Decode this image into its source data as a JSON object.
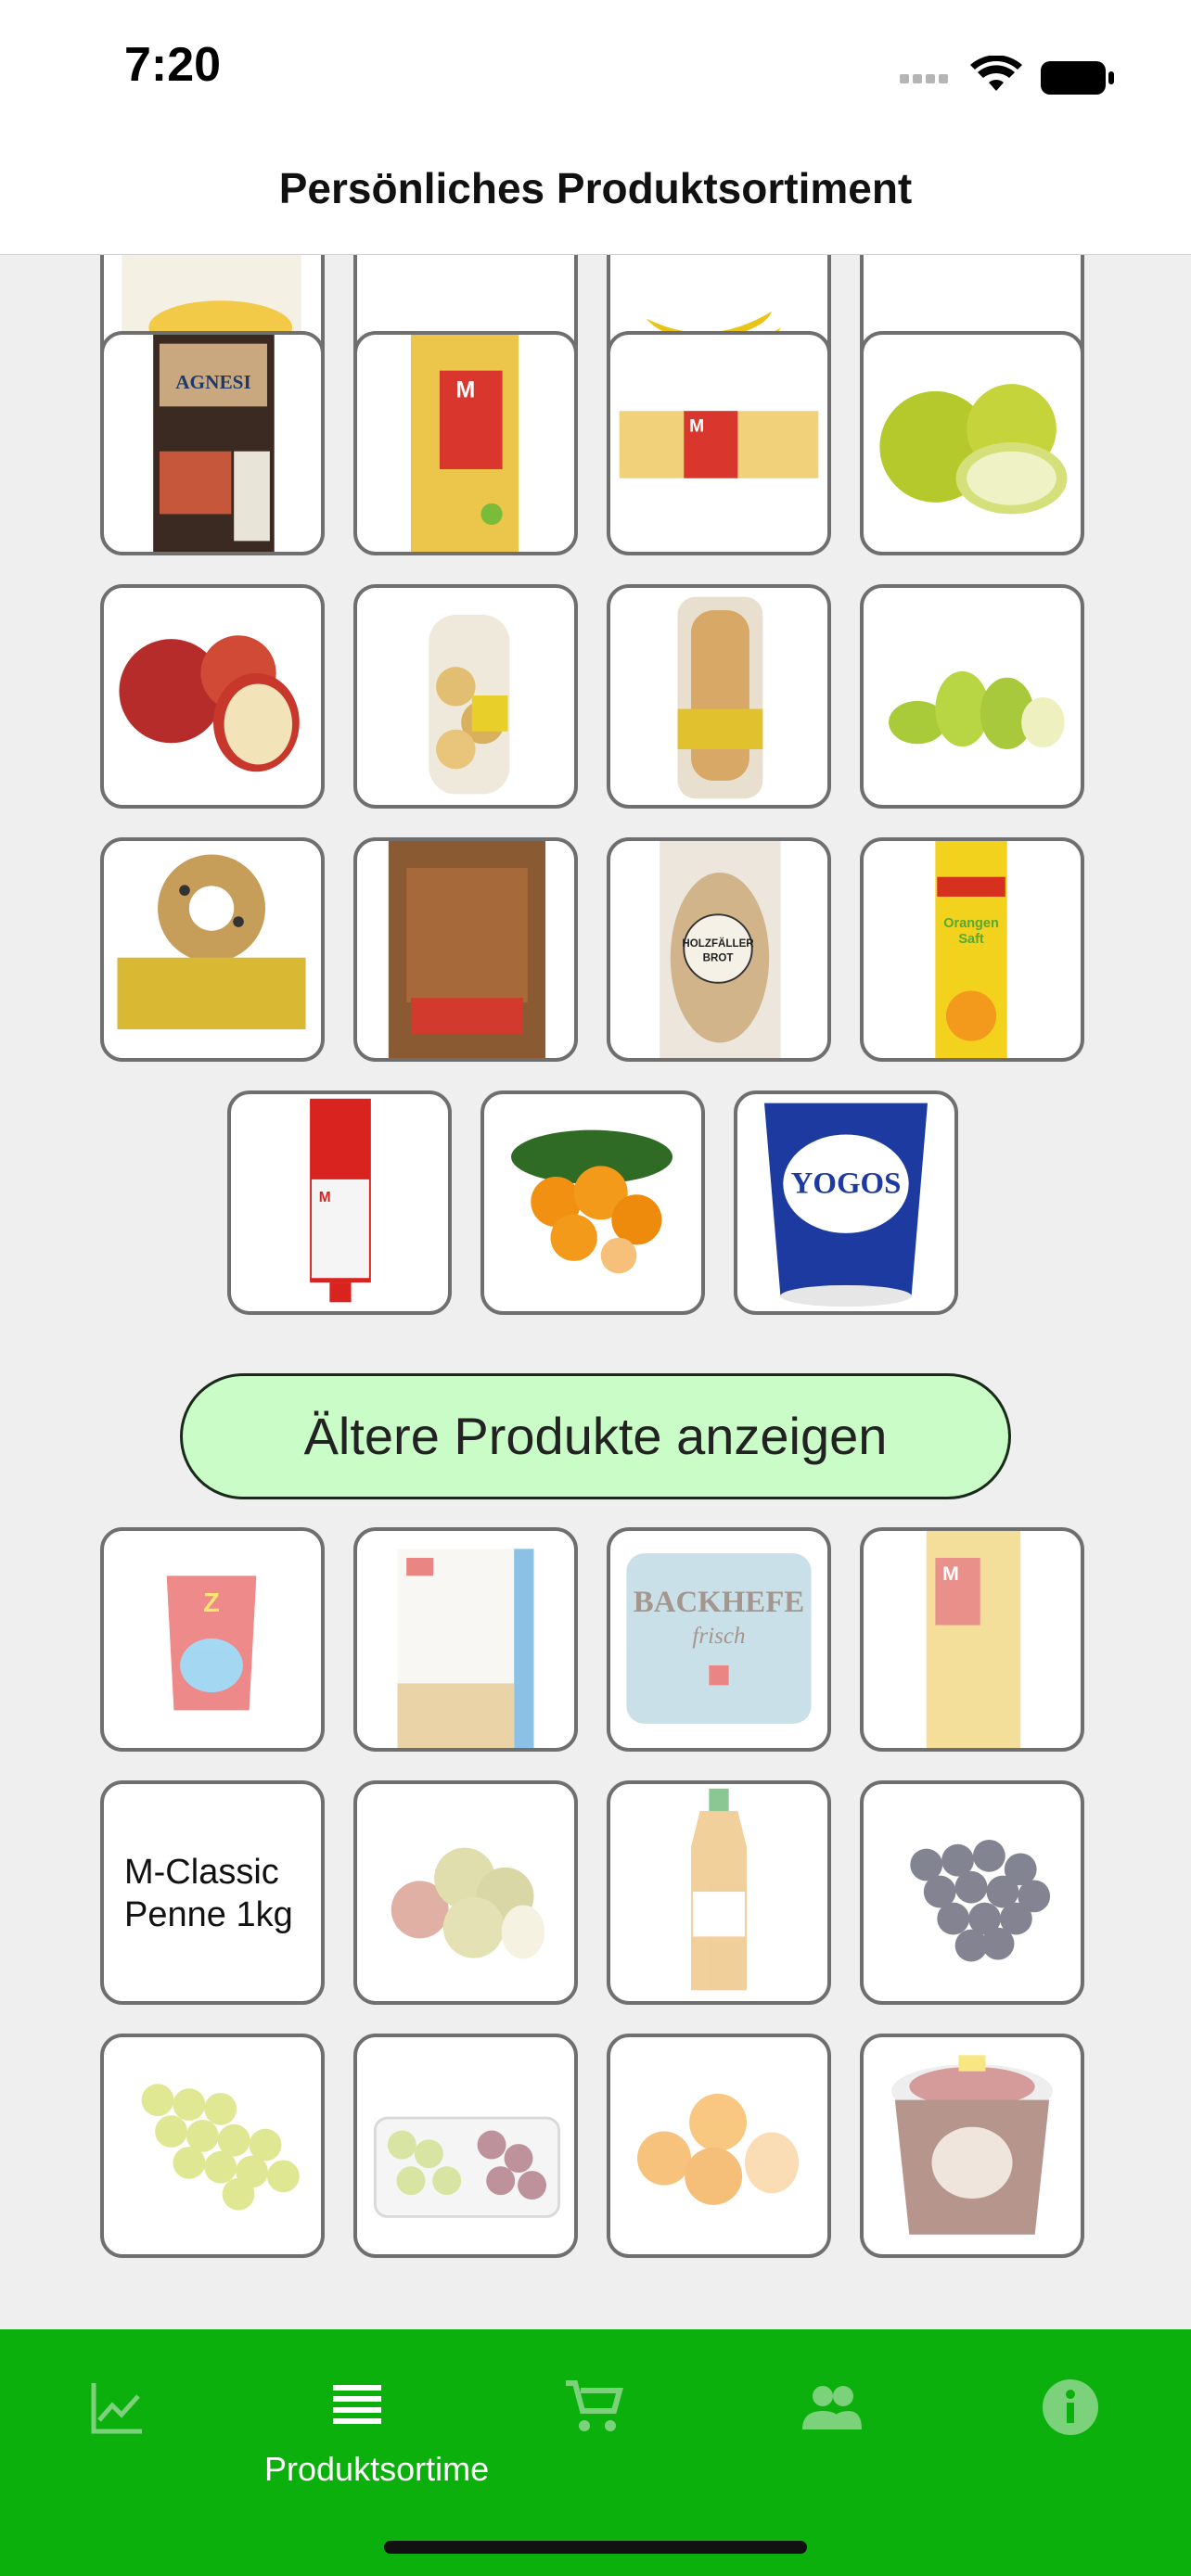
{
  "status_bar": {
    "time": "7:20"
  },
  "header": {
    "title": "Persönliches Produktsortiment"
  },
  "recent_products": [
    {
      "name": "Polenta"
    },
    {
      "name": "Produkt"
    },
    {
      "name": "Bananen"
    },
    {
      "name": "Produkt"
    },
    {
      "name": "Agnesi Lasagne"
    },
    {
      "name": "M Hörnli"
    },
    {
      "name": "M Spaghettini"
    },
    {
      "name": "Äpfel grün"
    },
    {
      "name": "Äpfel rot"
    },
    {
      "name": "Brötchen"
    },
    {
      "name": "Baguette"
    },
    {
      "name": "Birnen"
    },
    {
      "name": "Knusperkranz"
    },
    {
      "name": "Brot"
    },
    {
      "name": "Holzfäller-Brot"
    },
    {
      "name": "Orangensaft"
    },
    {
      "name": "Tomatenpüree"
    },
    {
      "name": "Mandarinen"
    },
    {
      "name": "Yogos Nature"
    }
  ],
  "older_button": {
    "label": "Ältere Produkte anzeigen"
  },
  "older_products": [
    {
      "name": "Zweifel Chips"
    },
    {
      "name": "Weissmehl"
    },
    {
      "name": "Backhefe frisch"
    },
    {
      "name": "M Nudeln"
    },
    {
      "name": "M-Classic Penne 1kg",
      "text": "M-Classic Penne 1kg"
    },
    {
      "name": "Äpfel"
    },
    {
      "name": "Eistee"
    },
    {
      "name": "Trauben blau"
    },
    {
      "name": "Trauben weiss"
    },
    {
      "name": "Trauben gemischt"
    },
    {
      "name": "Clementinen"
    },
    {
      "name": "Smarties Joghurt"
    }
  ],
  "tabbar": {
    "tabs": [
      {
        "icon": "chart-icon",
        "label": ""
      },
      {
        "icon": "list-icon",
        "label": "Produktsortime"
      },
      {
        "icon": "cart-icon",
        "label": ""
      },
      {
        "icon": "people-icon",
        "label": ""
      },
      {
        "icon": "info-icon",
        "label": ""
      }
    ],
    "active_index": 1
  },
  "colors": {
    "tabbar": "#0cb00c",
    "button": "#c9fcc6"
  }
}
